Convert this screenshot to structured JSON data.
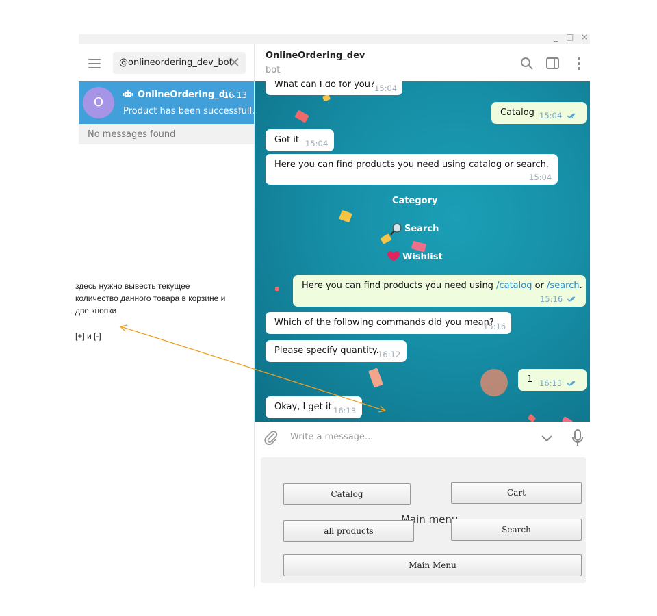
{
  "window": {
    "controls": [
      "_",
      "□",
      "×"
    ]
  },
  "sidebar": {
    "search_value": "@onlineordering_dev_bot",
    "chat": {
      "avatar_letter": "O",
      "name": "OnlineOrdering_d...",
      "time": "16:13",
      "preview": "Product has been successfull..."
    },
    "no_messages": "No messages found"
  },
  "header": {
    "title": "OnlineOrdering_dev",
    "subtitle": "bot"
  },
  "messages": {
    "m1": {
      "text": "What can I do for you?",
      "time": "15:04"
    },
    "m2": {
      "text": "Catalog",
      "time": "15:04"
    },
    "m3": {
      "text": "Got it",
      "time": "15:04"
    },
    "m4": {
      "text": "Here you can find products you need using catalog or search.",
      "time": "15:04"
    },
    "m5": {
      "text_before": "Here you can find products you need using ",
      "link1": "/catalog",
      "middle": " or ",
      "link2": "/search",
      "text_after": ".",
      "time": "15:16"
    },
    "m6": {
      "text": "Which of the following commands did you mean?",
      "time": "15:16"
    },
    "m7": {
      "text": "Please specify quantity.",
      "time": "16:12"
    },
    "m8": {
      "text": "1",
      "time": "16:13"
    },
    "m9": {
      "text": "Okay, I get it",
      "time": "16:13"
    }
  },
  "inline_labels": {
    "category": "Category",
    "search": "Search",
    "wishlist": "Wishlist"
  },
  "composer": {
    "placeholder": "Write a message..."
  },
  "keyboard": {
    "title": "Main menu",
    "buttons": {
      "catalog": "Catalog",
      "cart": "Cart",
      "all_products": "all products",
      "search": "Search",
      "main_menu": "Main Menu"
    }
  },
  "annotation": {
    "line1": "здесь нужно вывесть текущее",
    "line2": " количество данного товара в корзине и",
    "line3": "две кнопки",
    "line4": "[+] и [-]"
  },
  "colors": {
    "accent": "#419fd9",
    "avatar": "#a695e7",
    "annotation_arrow": "#f0a020",
    "outgoing_bubble": "#effdde"
  }
}
